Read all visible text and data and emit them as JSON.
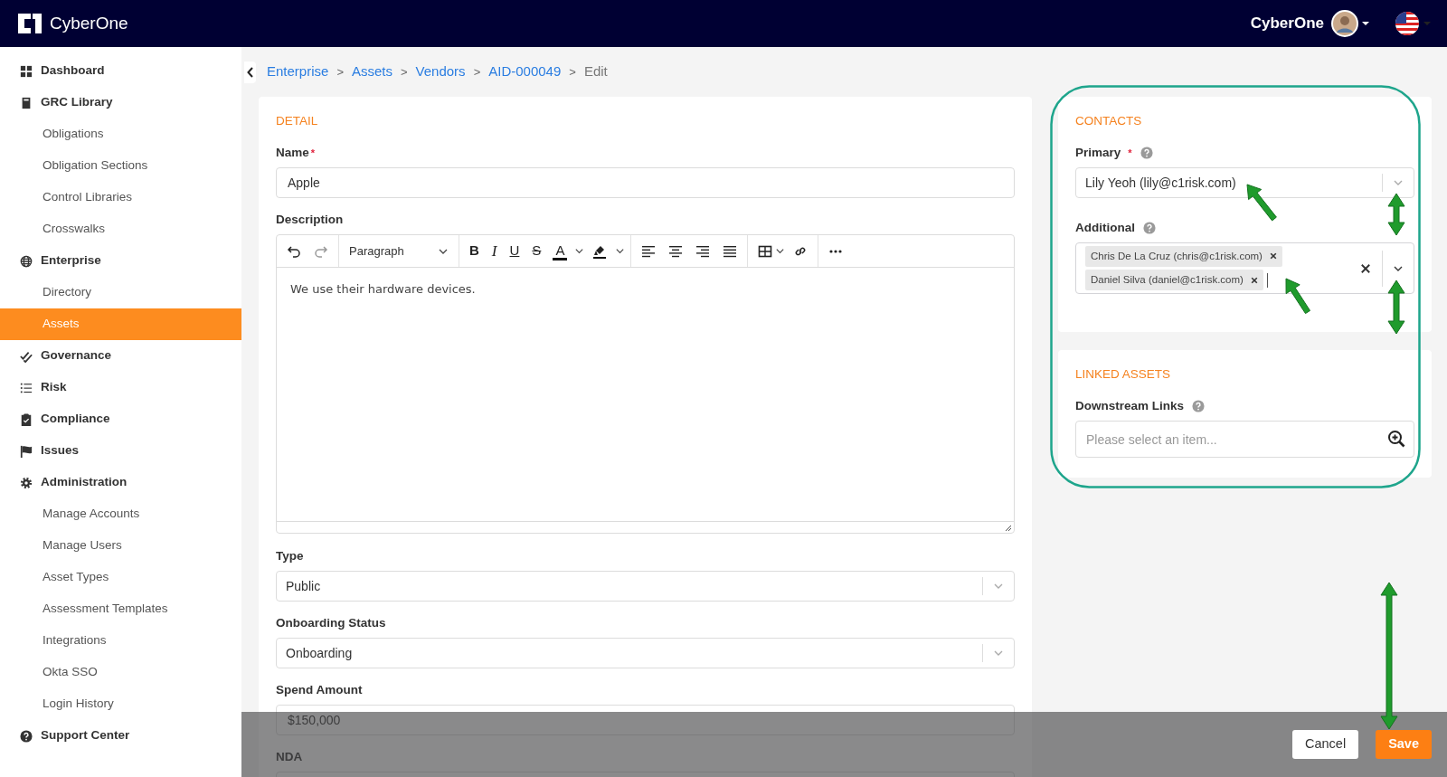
{
  "topbar": {
    "brand": "CyberOne",
    "user_name": "CyberOne"
  },
  "sidebar": {
    "items": [
      {
        "label": "Dashboard",
        "selected": false
      },
      {
        "label": "GRC Library",
        "selected": false,
        "children": [
          {
            "label": "Obligations",
            "selected": false
          },
          {
            "label": "Obligation Sections",
            "selected": false
          },
          {
            "label": "Control Libraries",
            "selected": false
          },
          {
            "label": "Crosswalks",
            "selected": false
          }
        ]
      },
      {
        "label": "Enterprise",
        "selected": false,
        "children": [
          {
            "label": "Directory",
            "selected": false
          },
          {
            "label": "Assets",
            "selected": true
          }
        ]
      },
      {
        "label": "Governance",
        "selected": false
      },
      {
        "label": "Risk",
        "selected": false
      },
      {
        "label": "Compliance",
        "selected": false
      },
      {
        "label": "Issues",
        "selected": false
      },
      {
        "label": "Administration",
        "selected": false,
        "children": [
          {
            "label": "Manage Accounts",
            "selected": false
          },
          {
            "label": "Manage Users",
            "selected": false
          },
          {
            "label": "Asset Types",
            "selected": false
          },
          {
            "label": "Assessment Templates",
            "selected": false
          },
          {
            "label": "Integrations",
            "selected": false
          },
          {
            "label": "Okta SSO",
            "selected": false
          },
          {
            "label": "Login History",
            "selected": false
          }
        ]
      },
      {
        "label": "Support Center",
        "selected": false
      }
    ]
  },
  "breadcrumb": {
    "items": [
      {
        "kind": "link",
        "label": "Enterprise",
        "separator": ">"
      },
      {
        "kind": "link",
        "label": "Assets",
        "separator": ">"
      },
      {
        "kind": "link",
        "label": "Vendors",
        "separator": ">"
      },
      {
        "kind": "link",
        "label": "AID-000049",
        "separator": ">"
      },
      {
        "kind": "current",
        "label": "Edit"
      }
    ]
  },
  "detail": {
    "title": "DETAIL",
    "fields": [
      {
        "kind": "text",
        "label": "Name",
        "required_mark": "*",
        "value": "Apple"
      },
      {
        "kind": "editor",
        "label": "Description",
        "block_style": "Paragraph",
        "format_buttons": [
          "B",
          "I",
          "U",
          "S",
          "A"
        ],
        "value": "We use their hardware devices."
      },
      {
        "kind": "select",
        "label": "Type",
        "value": "Public"
      },
      {
        "kind": "select",
        "label": "Onboarding Status",
        "value": "Onboarding"
      },
      {
        "kind": "text",
        "label": "Spend Amount",
        "value": "$150,000"
      },
      {
        "kind": "text",
        "label": "NDA"
      }
    ]
  },
  "contacts": {
    "title": "CONTACTS",
    "fields": [
      {
        "kind": "select",
        "label": "Primary",
        "required_mark": "*",
        "help": true,
        "value": "Lily Yeoh (lily@c1risk.com)"
      },
      {
        "kind": "multiselect",
        "label": "Additional",
        "help": true,
        "tags": [
          "Chris De La Cruz (chris@c1risk.com)",
          "Daniel Silva (daniel@c1risk.com)"
        ]
      }
    ]
  },
  "linked_assets": {
    "title": "LINKED ASSETS",
    "fields": [
      {
        "kind": "search",
        "label": "Downstream Links",
        "help": true,
        "placeholder": "Please select an item..."
      }
    ]
  },
  "footer": {
    "buttons": [
      {
        "kind": "secondary",
        "label": "Cancel"
      },
      {
        "kind": "primary",
        "label": "Save"
      }
    ]
  }
}
